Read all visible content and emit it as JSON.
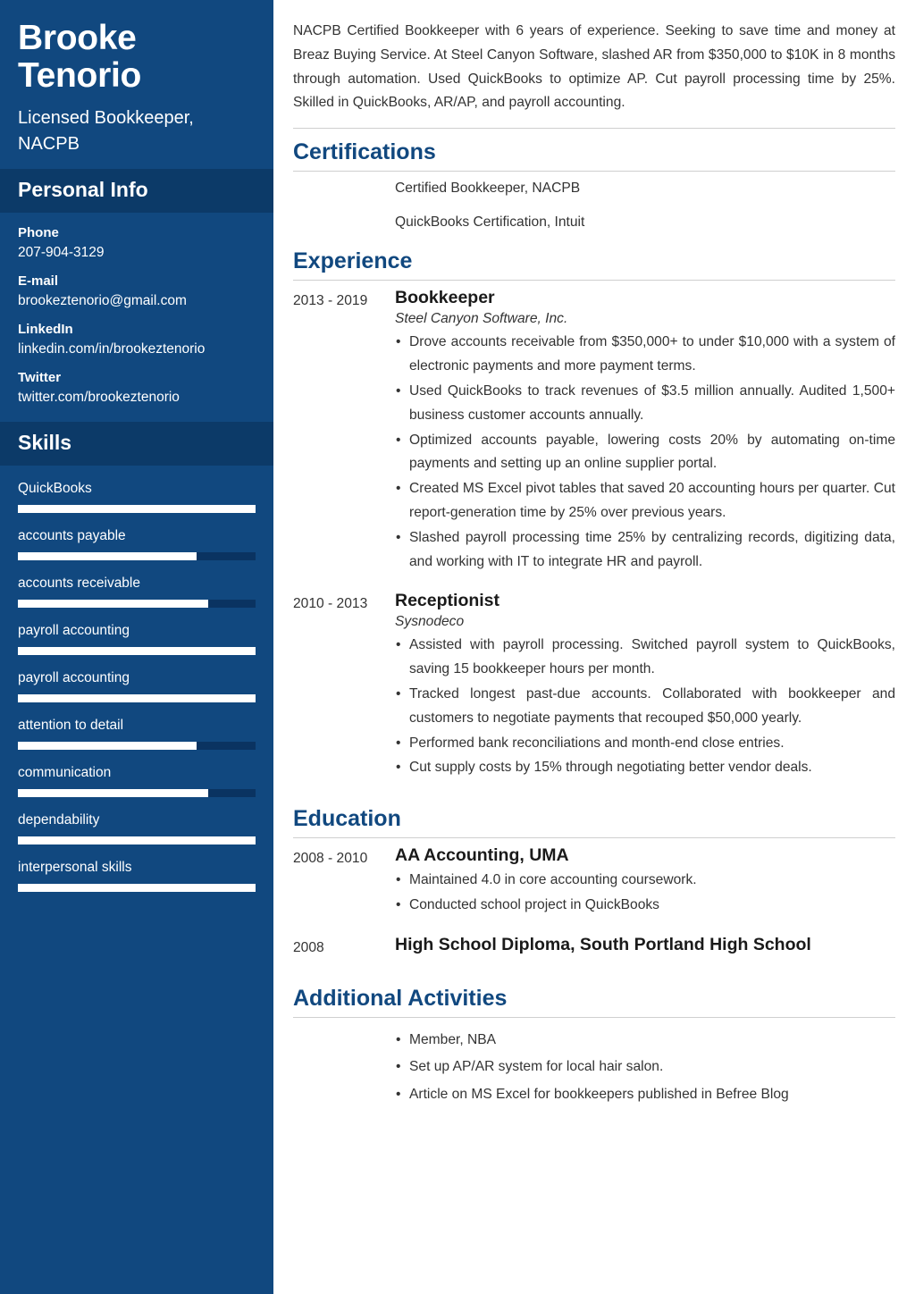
{
  "sidebar": {
    "name": "Brooke Tenorio",
    "job_title": "Licensed Bookkeeper, NACPB",
    "personal_info_heading": "Personal Info",
    "fields": [
      {
        "label": "Phone",
        "value": "207-904-3129"
      },
      {
        "label": "E-mail",
        "value": "brookeztenorio@gmail.com"
      },
      {
        "label": "LinkedIn",
        "value": "linkedin.com/in/brookeztenorio"
      },
      {
        "label": "Twitter",
        "value": "twitter.com/brookeztenorio"
      }
    ],
    "skills_heading": "Skills",
    "skills": [
      {
        "name": "QuickBooks",
        "level": 100
      },
      {
        "name": "accounts payable",
        "level": 75
      },
      {
        "name": "accounts receivable",
        "level": 80
      },
      {
        "name": "payroll accounting",
        "level": 100
      },
      {
        "name": "payroll accounting",
        "level": 100
      },
      {
        "name": "attention to detail",
        "level": 75
      },
      {
        "name": "communication",
        "level": 80
      },
      {
        "name": "dependability",
        "level": 100
      },
      {
        "name": "interpersonal skills",
        "level": 100
      }
    ]
  },
  "main": {
    "summary": "NACPB Certified Bookkeeper with 6 years of experience. Seeking to save time and money at Breaz Buying Service. At Steel Canyon Software, slashed AR from $350,000 to $10K in 8 months through automation. Used QuickBooks to optimize AP. Cut payroll processing time by 25%. Skilled in QuickBooks, AR/AP, and payroll accounting.",
    "certifications": {
      "heading": "Certifications",
      "items": [
        "Certified Bookkeeper, NACPB",
        "QuickBooks Certification, Intuit"
      ]
    },
    "experience": {
      "heading": "Experience",
      "entries": [
        {
          "date": "2013 - 2019",
          "title": "Bookkeeper",
          "company": "Steel Canyon Software, Inc.",
          "bullets": [
            "Drove accounts receivable from $350,000+ to under $10,000 with a system of electronic payments and more payment terms.",
            "Used QuickBooks to track revenues of $3.5 million annually. Audited 1,500+ business customer accounts annually.",
            "Optimized accounts payable, lowering costs 20% by automating on-time payments and setting up an online supplier portal.",
            "Created MS Excel pivot tables that saved 20 accounting hours per quarter. Cut report-generation time by 25% over previous years.",
            "Slashed payroll processing time 25% by centralizing records, digitizing data, and working with IT to integrate HR and payroll."
          ]
        },
        {
          "date": "2010 - 2013",
          "title": "Receptionist",
          "company": "Sysnodeco",
          "bullets": [
            "Assisted with payroll processing. Switched payroll system to QuickBooks, saving 15 bookkeeper hours per month.",
            "Tracked longest past-due accounts. Collaborated with bookkeeper and customers to negotiate payments that recouped $50,000 yearly.",
            "Performed bank reconciliations and month-end close entries.",
            "Cut supply costs by 15% through negotiating better vendor deals."
          ]
        }
      ]
    },
    "education": {
      "heading": "Education",
      "entries": [
        {
          "date": "2008 - 2010",
          "title": "AA Accounting, UMA",
          "bullets": [
            "Maintained 4.0 in core accounting coursework.",
            "Conducted school project in QuickBooks"
          ]
        },
        {
          "date": "2008",
          "title": "High School Diploma, South Portland High School",
          "bullets": []
        }
      ]
    },
    "additional": {
      "heading": "Additional Activities",
      "items": [
        "Member, NBA",
        "Set up AP/AR system for local hair salon.",
        "Article on MS Excel for bookkeepers published in Befree Blog"
      ]
    }
  },
  "colors": {
    "sidebar_bg": "#11487f",
    "sidebar_head_bg": "#0c3a68",
    "accent": "#11487f",
    "skill_track": "#0a3361",
    "skill_fill": "#ffffff"
  }
}
